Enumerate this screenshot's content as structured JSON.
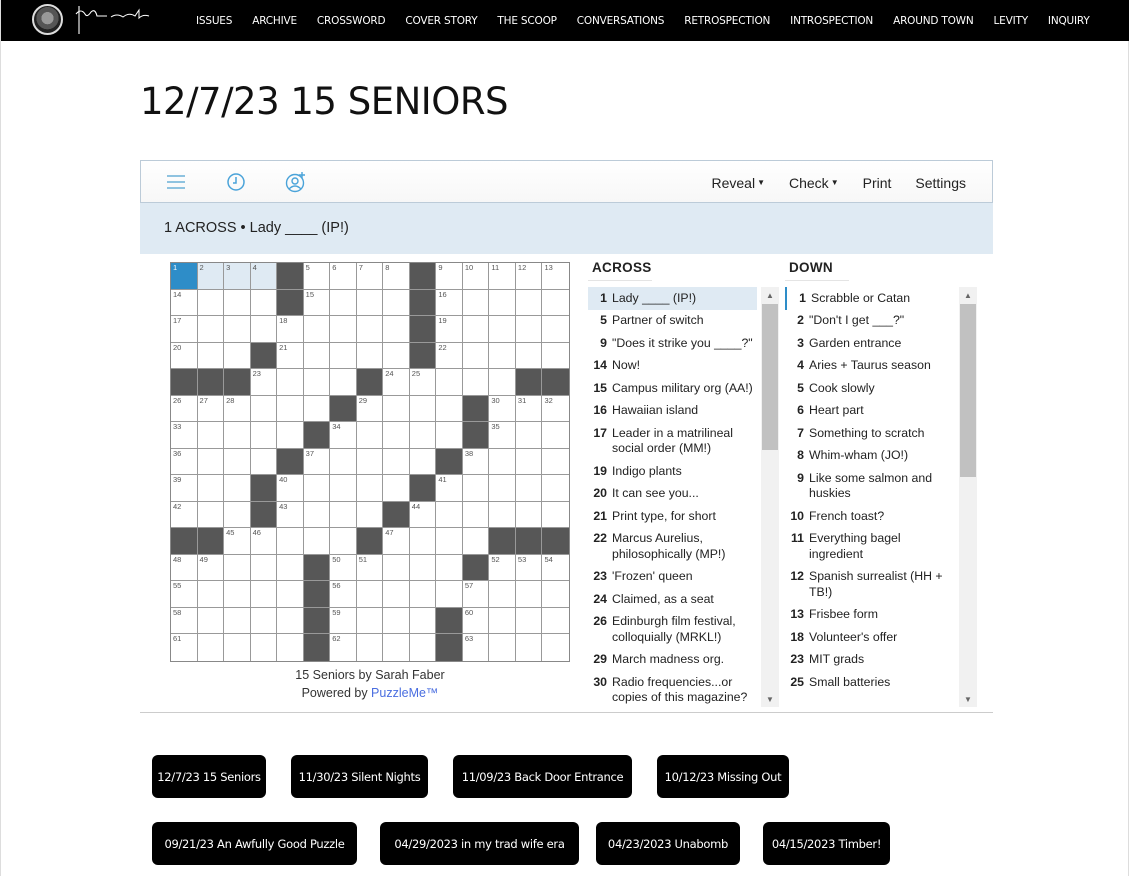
{
  "nav": {
    "logo_alt": "seal-logo",
    "links": [
      "ISSUES",
      "ARCHIVE",
      "CROSSWORD",
      "COVER STORY",
      "THE SCOOP",
      "CONVERSATIONS",
      "RETROSPECTION",
      "INTROSPECTION",
      "AROUND TOWN",
      "LEVITY",
      "INQUIRY"
    ]
  },
  "page": {
    "title": "12/7/23 15 SENIORS"
  },
  "toolbar": {
    "icons": [
      "menu-icon",
      "clock-icon",
      "add-user-icon"
    ],
    "reveal": "Reveal",
    "check": "Check",
    "print": "Print",
    "settings": "Settings"
  },
  "current_clue": "1 ACROSS • Lady ____ (IP!)",
  "grid": {
    "rows": [
      "....#....#.....",
      "....#....#.....",
      ".........#.....",
      "...#.....#.....",
      "###....#.....##",
      "......#....#...",
      ".....#.....#...",
      "....#.....#....",
      "...#.....#.....",
      "...#....#......",
      "##.....#....###",
      ".....#.....#...",
      ".....#.........",
      ".....#....#....",
      ".....#....#...."
    ],
    "selected_cell": [
      0,
      0
    ],
    "highlighted_cells": [
      [
        0,
        1
      ],
      [
        0,
        2
      ],
      [
        0,
        3
      ]
    ]
  },
  "credits": {
    "byline": "15 Seniors by Sarah Faber",
    "powered_prefix": "Powered by ",
    "powered_link": "PuzzleMe™"
  },
  "across": {
    "heading": "ACROSS",
    "clues": [
      {
        "n": "1",
        "text": "Lady ____ (IP!)"
      },
      {
        "n": "5",
        "text": "Partner of switch"
      },
      {
        "n": "9",
        "text": "\"Does it strike you ____?\""
      },
      {
        "n": "14",
        "text": "Now!"
      },
      {
        "n": "15",
        "text": "Campus military org (AA!)"
      },
      {
        "n": "16",
        "text": "Hawaiian island"
      },
      {
        "n": "17",
        "text": "Leader in a matrilineal social order (MM!)"
      },
      {
        "n": "19",
        "text": "Indigo plants"
      },
      {
        "n": "20",
        "text": "It can see you..."
      },
      {
        "n": "21",
        "text": "Print type, for short"
      },
      {
        "n": "22",
        "text": "Marcus Aurelius, philosophically (MP!)"
      },
      {
        "n": "23",
        "text": "'Frozen' queen"
      },
      {
        "n": "24",
        "text": "Claimed, as a seat"
      },
      {
        "n": "26",
        "text": "Edinburgh film festival, colloquially (MRKL!)"
      },
      {
        "n": "29",
        "text": "March madness org."
      },
      {
        "n": "30",
        "text": "Radio frequencies...or copies of this magazine?"
      }
    ]
  },
  "down": {
    "heading": "DOWN",
    "clues": [
      {
        "n": "1",
        "text": "Scrabble or Catan"
      },
      {
        "n": "2",
        "text": "\"Don't I get ___?\""
      },
      {
        "n": "3",
        "text": "Garden entrance"
      },
      {
        "n": "4",
        "text": "Aries + Taurus season"
      },
      {
        "n": "5",
        "text": "Cook slowly"
      },
      {
        "n": "6",
        "text": "Heart part"
      },
      {
        "n": "7",
        "text": "Something to scratch"
      },
      {
        "n": "8",
        "text": "Whim-wham (JO!)"
      },
      {
        "n": "9",
        "text": "Like some salmon and huskies"
      },
      {
        "n": "10",
        "text": "French toast?"
      },
      {
        "n": "11",
        "text": "Everything bagel ingredient"
      },
      {
        "n": "12",
        "text": "Spanish surrealist (HH + TB!)"
      },
      {
        "n": "13",
        "text": "Frisbee form"
      },
      {
        "n": "18",
        "text": "Volunteer's offer"
      },
      {
        "n": "23",
        "text": "MIT grads"
      },
      {
        "n": "25",
        "text": "Small batteries"
      }
    ]
  },
  "archive": [
    "12/7/23 15 Seniors",
    "11/30/23 Silent Nights",
    "11/09/23 Back Door Entrance",
    "10/12/23 Missing Out",
    "09/21/23 An Awfully Good Puzzle",
    "04/29/2023 in my trad wife era",
    "04/23/2023 Unabomb",
    "04/15/2023 Timber!"
  ],
  "colors": {
    "selected_cell": "#2e8dc8",
    "highlight": "#dfeaf3",
    "black_cell": "#575757",
    "link": "#4a6ee0"
  }
}
